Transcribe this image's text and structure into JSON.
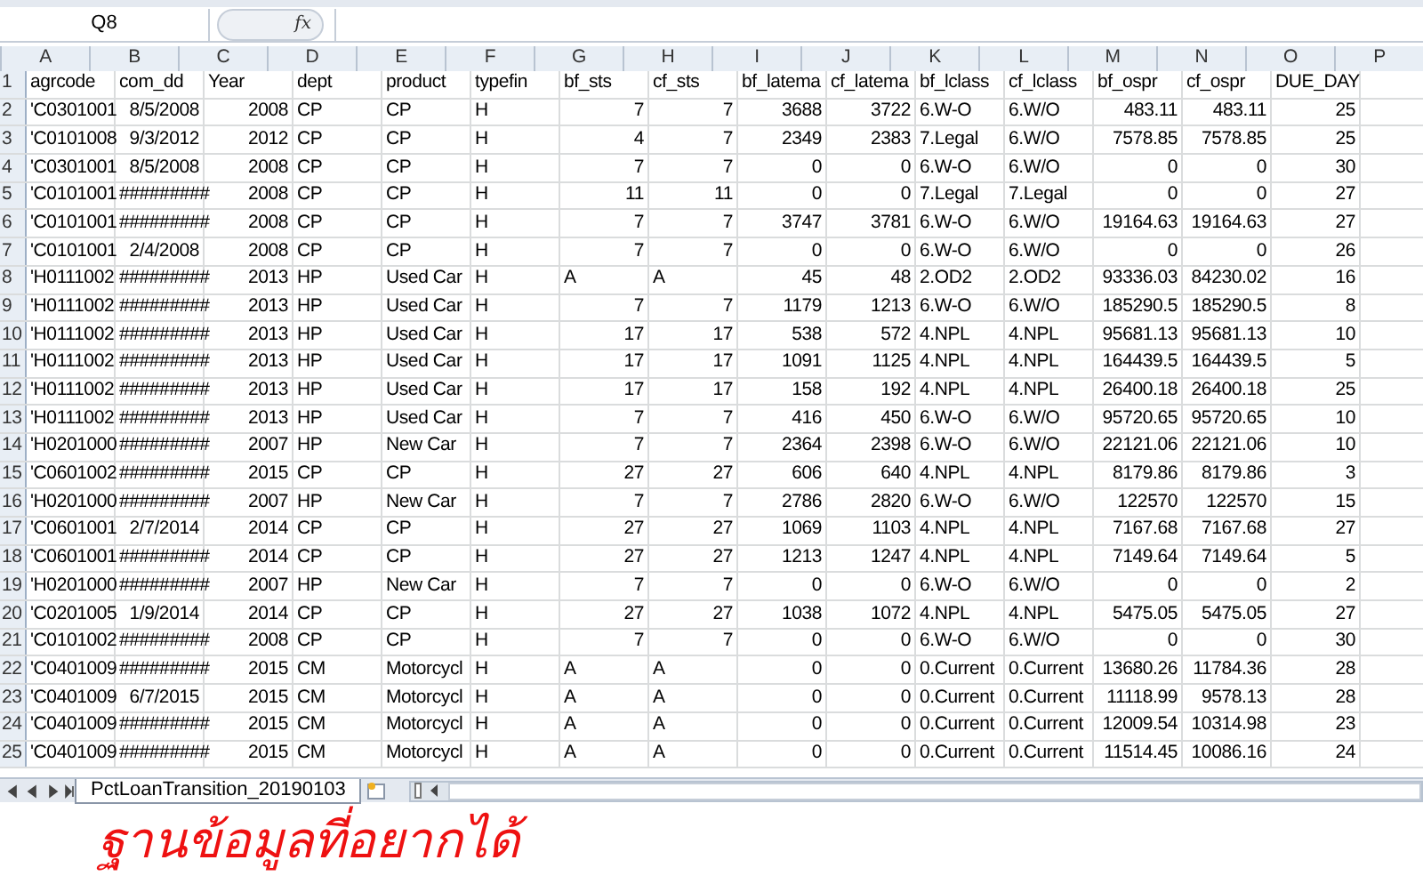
{
  "name_box": "Q8",
  "formula_label": "fx",
  "columns": [
    "A",
    "B",
    "C",
    "D",
    "E",
    "F",
    "G",
    "H",
    "I",
    "J",
    "K",
    "L",
    "M",
    "N",
    "O",
    "P"
  ],
  "rows": [
    {
      "number": "1",
      "cells": [
        "agrcode",
        "com_dd",
        "Year",
        "dept",
        "product",
        "typefin",
        "bf_sts",
        "cf_sts",
        "bf_latema",
        "cf_latema",
        "bf_lclass",
        "cf_lclass",
        "bf_ospr",
        "cf_ospr",
        "DUE_DAY"
      ]
    },
    {
      "number": "2",
      "cells": [
        "'C0301001",
        "8/5/2008",
        "2008",
        "CP",
        "CP",
        "H",
        "7",
        "7",
        "3688",
        "3722",
        "6.W-O",
        "6.W/O",
        "483.11",
        "483.11",
        "25"
      ]
    },
    {
      "number": "3",
      "cells": [
        "'C0101008",
        "9/3/2012",
        "2012",
        "CP",
        "CP",
        "H",
        "4",
        "7",
        "2349",
        "2383",
        "7.Legal",
        "6.W/O",
        "7578.85",
        "7578.85",
        "25"
      ]
    },
    {
      "number": "4",
      "cells": [
        "'C0301001",
        "8/5/2008",
        "2008",
        "CP",
        "CP",
        "H",
        "7",
        "7",
        "0",
        "0",
        "6.W-O",
        "6.W/O",
        "0",
        "0",
        "30"
      ]
    },
    {
      "number": "5",
      "cells": [
        "'C0101001",
        "#########",
        "2008",
        "CP",
        "CP",
        "H",
        "11",
        "11",
        "0",
        "0",
        "7.Legal",
        "7.Legal",
        "0",
        "0",
        "27"
      ]
    },
    {
      "number": "6",
      "cells": [
        "'C0101001",
        "#########",
        "2008",
        "CP",
        "CP",
        "H",
        "7",
        "7",
        "3747",
        "3781",
        "6.W-O",
        "6.W/O",
        "19164.63",
        "19164.63",
        "27"
      ]
    },
    {
      "number": "7",
      "cells": [
        "'C0101001",
        "2/4/2008",
        "2008",
        "CP",
        "CP",
        "H",
        "7",
        "7",
        "0",
        "0",
        "6.W-O",
        "6.W/O",
        "0",
        "0",
        "26"
      ]
    },
    {
      "number": "8",
      "cells": [
        "'H0111002",
        "#########",
        "2013",
        "HP",
        "Used Car",
        "H",
        "A",
        "A",
        "45",
        "48",
        "2.OD2",
        "2.OD2",
        "93336.03",
        "84230.02",
        "16"
      ]
    },
    {
      "number": "9",
      "cells": [
        "'H0111002",
        "#########",
        "2013",
        "HP",
        "Used Car",
        "H",
        "7",
        "7",
        "1179",
        "1213",
        "6.W-O",
        "6.W/O",
        "185290.5",
        "185290.5",
        "8"
      ]
    },
    {
      "number": "10",
      "cells": [
        "'H0111002",
        "#########",
        "2013",
        "HP",
        "Used Car",
        "H",
        "17",
        "17",
        "538",
        "572",
        "4.NPL",
        "4.NPL",
        "95681.13",
        "95681.13",
        "10"
      ]
    },
    {
      "number": "11",
      "cells": [
        "'H0111002",
        "#########",
        "2013",
        "HP",
        "Used Car",
        "H",
        "17",
        "17",
        "1091",
        "1125",
        "4.NPL",
        "4.NPL",
        "164439.5",
        "164439.5",
        "5"
      ]
    },
    {
      "number": "12",
      "cells": [
        "'H0111002",
        "#########",
        "2013",
        "HP",
        "Used Car",
        "H",
        "17",
        "17",
        "158",
        "192",
        "4.NPL",
        "4.NPL",
        "26400.18",
        "26400.18",
        "25"
      ]
    },
    {
      "number": "13",
      "cells": [
        "'H0111002",
        "#########",
        "2013",
        "HP",
        "Used Car",
        "H",
        "7",
        "7",
        "416",
        "450",
        "6.W-O",
        "6.W/O",
        "95720.65",
        "95720.65",
        "10"
      ]
    },
    {
      "number": "14",
      "cells": [
        "'H0201000",
        "#########",
        "2007",
        "HP",
        "New Car",
        "H",
        "7",
        "7",
        "2364",
        "2398",
        "6.W-O",
        "6.W/O",
        "22121.06",
        "22121.06",
        "10"
      ]
    },
    {
      "number": "15",
      "cells": [
        "'C0601002",
        "#########",
        "2015",
        "CP",
        "CP",
        "H",
        "27",
        "27",
        "606",
        "640",
        "4.NPL",
        "4.NPL",
        "8179.86",
        "8179.86",
        "3"
      ]
    },
    {
      "number": "16",
      "cells": [
        "'H0201000",
        "#########",
        "2007",
        "HP",
        "New Car",
        "H",
        "7",
        "7",
        "2786",
        "2820",
        "6.W-O",
        "6.W/O",
        "122570",
        "122570",
        "15"
      ]
    },
    {
      "number": "17",
      "cells": [
        "'C0601001",
        "2/7/2014",
        "2014",
        "CP",
        "CP",
        "H",
        "27",
        "27",
        "1069",
        "1103",
        "4.NPL",
        "4.NPL",
        "7167.68",
        "7167.68",
        "27"
      ]
    },
    {
      "number": "18",
      "cells": [
        "'C0601001",
        "#########",
        "2014",
        "CP",
        "CP",
        "H",
        "27",
        "27",
        "1213",
        "1247",
        "4.NPL",
        "4.NPL",
        "7149.64",
        "7149.64",
        "5"
      ]
    },
    {
      "number": "19",
      "cells": [
        "'H0201000",
        "#########",
        "2007",
        "HP",
        "New Car",
        "H",
        "7",
        "7",
        "0",
        "0",
        "6.W-O",
        "6.W/O",
        "0",
        "0",
        "2"
      ]
    },
    {
      "number": "20",
      "cells": [
        "'C0201005",
        "1/9/2014",
        "2014",
        "CP",
        "CP",
        "H",
        "27",
        "27",
        "1038",
        "1072",
        "4.NPL",
        "4.NPL",
        "5475.05",
        "5475.05",
        "27"
      ]
    },
    {
      "number": "21",
      "cells": [
        "'C0101002",
        "#########",
        "2008",
        "CP",
        "CP",
        "H",
        "7",
        "7",
        "0",
        "0",
        "6.W-O",
        "6.W/O",
        "0",
        "0",
        "30"
      ]
    },
    {
      "number": "22",
      "cells": [
        "'C0401009",
        "#########",
        "2015",
        "CM",
        "Motorcycl",
        "H",
        "A",
        "A",
        "0",
        "0",
        "0.Current",
        "0.Current",
        "13680.26",
        "11784.36",
        "28"
      ]
    },
    {
      "number": "23",
      "cells": [
        "'C0401009",
        "6/7/2015",
        "2015",
        "CM",
        "Motorcycl",
        "H",
        "A",
        "A",
        "0",
        "0",
        "0.Current",
        "0.Current",
        "11118.99",
        "9578.13",
        "28"
      ]
    },
    {
      "number": "24",
      "cells": [
        "'C0401009",
        "#########",
        "2015",
        "CM",
        "Motorcycl",
        "H",
        "A",
        "A",
        "0",
        "0",
        "0.Current",
        "0.Current",
        "12009.54",
        "10314.98",
        "23"
      ]
    },
    {
      "number": "25",
      "cells": [
        "'C0401009",
        "#########",
        "2015",
        "CM",
        "Motorcycl",
        "H",
        "A",
        "A",
        "0",
        "0",
        "0.Current",
        "0.Current",
        "11514.45",
        "10086.16",
        "24"
      ]
    }
  ],
  "sheet_tabs": [
    {
      "label": "PctLoanTransition_20190103",
      "selected": true
    }
  ],
  "annotation": {
    "text": "ฐานข้อมูลที่อยากได้"
  }
}
